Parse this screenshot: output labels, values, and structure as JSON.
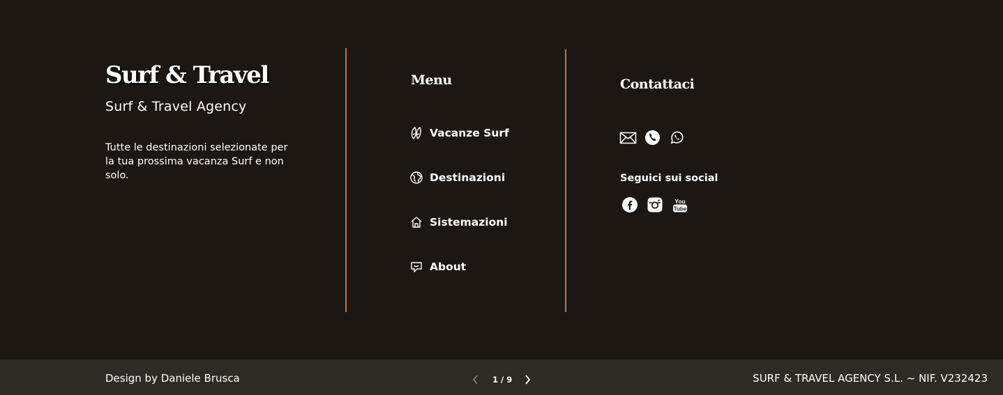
{
  "brand": {
    "title": "Surf & Travel",
    "subtitle": "Surf & Travel Agency",
    "description": "Tutte le destinazioni selezionate per la tua prossima vacanza Surf e non solo."
  },
  "menu": {
    "heading": "Menu",
    "items": [
      {
        "label": "Vacanze Surf",
        "icon": "surfboard-icon"
      },
      {
        "label": "Destinazioni",
        "icon": "globe-icon"
      },
      {
        "label": "Sistemazioni",
        "icon": "house-icon"
      },
      {
        "label": "About",
        "icon": "chat-icon"
      }
    ]
  },
  "contact": {
    "heading": "Contattaci",
    "icons": [
      "mail-icon",
      "phone-icon",
      "whatsapp-icon"
    ],
    "social_heading": "Seguici sui social",
    "social_icons": [
      "facebook-icon",
      "instagram-icon",
      "youtube-icon"
    ]
  },
  "bottom_bar": {
    "credit": "Design by Daniele Brusca",
    "page_indicator": "1 / 9",
    "legal": "SURF & TRAVEL AGENCY S.L. ~ NIF. V232423"
  },
  "colors": {
    "background": "#1c1712",
    "bottom_bar": "#2e2a25",
    "divider": "#b7773d",
    "text": "#ffffff"
  }
}
